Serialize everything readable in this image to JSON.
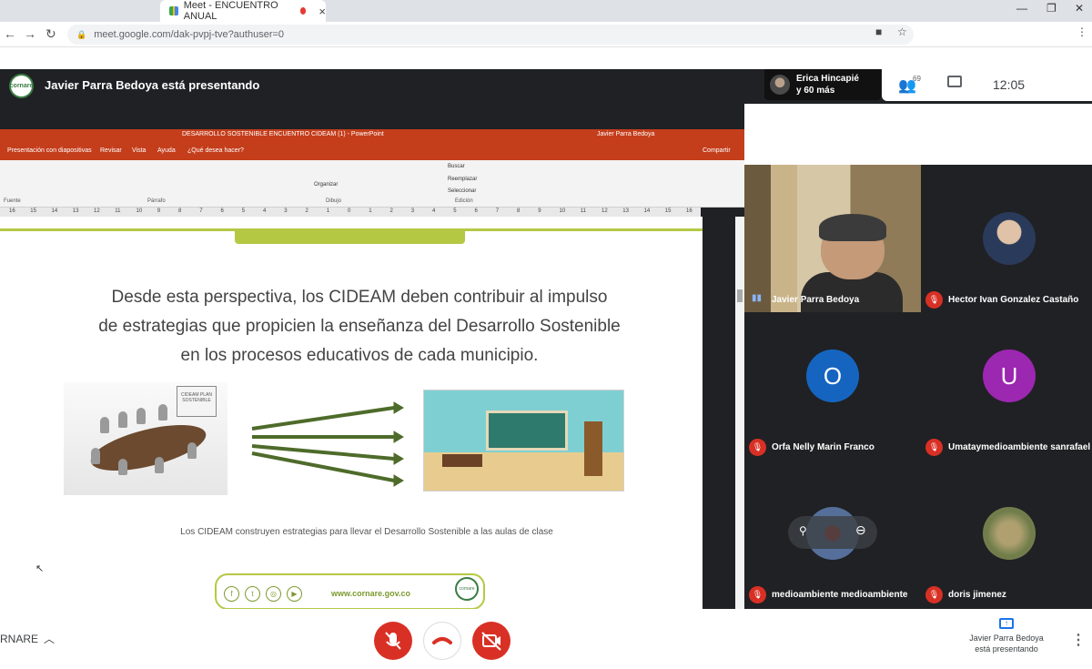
{
  "browser": {
    "tab_title": "Meet - ENCUENTRO ANUAL",
    "url": "meet.google.com/dak-pvpj-tve?authuser=0"
  },
  "meet": {
    "presenting_title": "Javier Parra Bedoya está presentando",
    "pinned_participant": {
      "line1": "Erica Hincapié",
      "line2": "y 60 más"
    },
    "people_count": "69",
    "clock": "12:05",
    "meeting_name": "RNARE",
    "presenting_card": {
      "line1": "Javier Parra Bedoya",
      "line2": "está presentando"
    }
  },
  "ppt": {
    "window_title": "DESARROLLO SOSTENIBLE ENCUENTRO CIDEAM (1) - PowerPoint",
    "user": "Javier Parra Bedoya",
    "menu": [
      "Presentación con diapositivas",
      "Revisar",
      "Vista",
      "Ayuda",
      "¿Qué desea hacer?",
      "Compartir"
    ],
    "ribbon_groups": [
      "Fuente",
      "Párrafo",
      "Dibujo",
      "Edición"
    ],
    "ribbon_cmds": [
      "Buscar",
      "Reemplazar",
      "Seleccionar",
      "Organizar"
    ],
    "ruler": [
      "16",
      "15",
      "14",
      "13",
      "12",
      "11",
      "10",
      "9",
      "8",
      "7",
      "6",
      "5",
      "4",
      "3",
      "2",
      "1",
      "0",
      "1",
      "2",
      "3",
      "4",
      "5",
      "6",
      "7",
      "8",
      "9",
      "10",
      "11",
      "12",
      "13",
      "14",
      "15",
      "16"
    ]
  },
  "slide": {
    "line1": "Desde esta perspectiva, los CIDEAM deben  contribuir al  impulso",
    "line2": "de estrategias que propicien la enseñanza del Desarrollo Sostenible",
    "line3": "en los procesos educativos de cada municipio.",
    "board_text": "CIDEAM PLAN SOSTENIBLE",
    "caption": "Los CIDEAM  construyen estrategias para llevar el Desarrollo Sostenible a las aulas de clase",
    "footer_url": "www.cornare.gov.co",
    "footer_logo": "cornare",
    "social": [
      "f",
      "t",
      "◎",
      "▶"
    ]
  },
  "participants": [
    {
      "name": "Javier Parra Bedoya",
      "type": "video"
    },
    {
      "name": "Hector Ivan Gonzalez Castaño",
      "type": "photo",
      "photo_color": "#c9a98e"
    },
    {
      "name": "Orfa Nelly Marin Franco",
      "type": "letter",
      "letter": "O",
      "color": "#1565c0"
    },
    {
      "name": "Umataymedioambiente sanrafael",
      "type": "letter",
      "letter": "U",
      "color": "#9c27b0"
    },
    {
      "name": "medioambiente medioambiente",
      "type": "photo",
      "photo_color": "#556f9a"
    },
    {
      "name": "doris jimenez",
      "type": "photo",
      "photo_color": "#8a7a55"
    }
  ],
  "colors": {
    "ppt_orange": "#c43e1c",
    "meet_dark": "#202124",
    "slide_green": "#b5c843",
    "end_call_red": "#d93025"
  },
  "icons": [
    "back-icon",
    "forward-icon",
    "reload-icon",
    "lock-icon",
    "camera-icon",
    "star-icon",
    "people-icon",
    "chat-icon",
    "mic-off-icon",
    "end-call-icon",
    "camera-off-icon",
    "present-icon",
    "more-vert-icon"
  ]
}
